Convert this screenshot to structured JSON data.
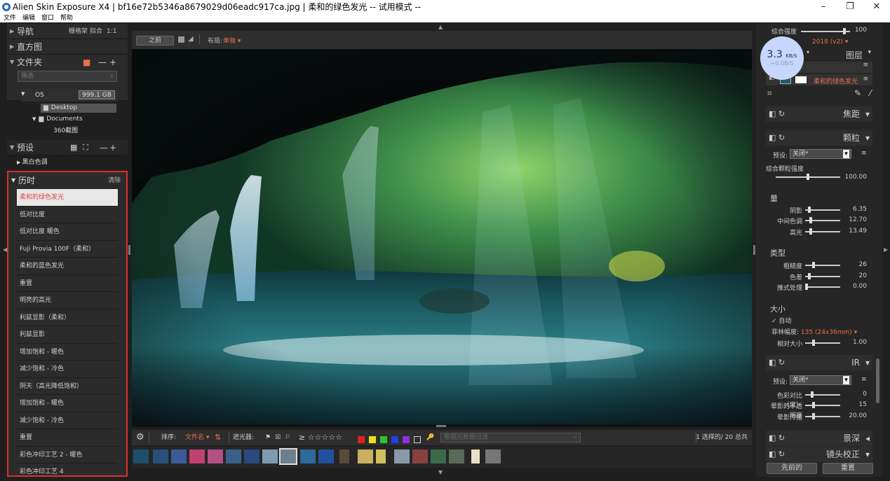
{
  "window": {
    "title": "Alien Skin Exposure X4 | bf16e72b5346a8679029d06eadc917ca.jpg | 柔和的绿色发光 -- 试用模式 --",
    "min": "–",
    "max": "❐",
    "close": "✕"
  },
  "menu": [
    "文件",
    "编辑",
    "窗口",
    "帮助"
  ],
  "left": {
    "nav": {
      "label": "导航",
      "opts": [
        "栅格架",
        "拟合",
        "1:1"
      ]
    },
    "histogram": "直方图",
    "folders": {
      "label": "文件夹",
      "filter_placeholder": "筛选",
      "drive": "OS",
      "drive_size": "999.1 GB",
      "tree": [
        "Desktop",
        "Documents",
        "360截图"
      ]
    },
    "presets": {
      "label": "预设",
      "item": "黑白色调"
    },
    "history": {
      "label": "历时",
      "clear": "清除",
      "items": [
        "柔和的绿色发光",
        "低对比度",
        "低对比度 暖色",
        "Fuji Provia 100F（柔和）",
        "柔和的蓝色发光",
        "重置",
        "明亮的高光",
        "利兹显影（柔和）",
        "利兹显影",
        "增加饱和 - 暖色",
        "减少饱和 - 冷色",
        "阴天（高光降低饱和）",
        "增加饱和 - 暖色",
        "减少饱和 - 冷色",
        "重置",
        "彩色冲印工艺 2 - 暖色",
        "彩色冲印工艺 4"
      ]
    }
  },
  "toolbar": {
    "before": "之前",
    "layout_label": "布局:",
    "layout_value": "单独"
  },
  "bottom": {
    "sort_label": "排序:",
    "sort_value": "文件名",
    "filter_label": "遮光器:",
    "stars": "☆☆☆☆☆",
    "search_placeholder": "根据元数据过滤",
    "count": "1 选择的/ 20 总共"
  },
  "colors": {
    "accent": "#e8704a",
    "red_border": "#d9302b",
    "swatches": [
      "#e02020",
      "#e8e020",
      "#30c030",
      "#2040e0",
      "#9030e0"
    ]
  },
  "right": {
    "overall_label": "综合强度",
    "overall_value": "100",
    "version": "2018 (v2)",
    "layers_label": "图层",
    "layer_name": "柔和的绿色发光",
    "net_speed": "3.3",
    "net_unit": "KB/S",
    "net_sub": "+0.0B/S",
    "focus": "焦距",
    "grain": "颗粒",
    "ir": "IR",
    "dof": "景深",
    "lens": "镜头校正",
    "preset_label": "预设:",
    "preset_value": "关闭*",
    "grain_overall": "综合颗粒强度",
    "grain_overall_val": "100.00",
    "amount": "量",
    "shadow": "阴影",
    "shadow_val": "6.35",
    "mid": "中间色调",
    "mid_val": "12.70",
    "high": "高光",
    "high_val": "13.49",
    "type": "类型",
    "rough": "粗糙度",
    "rough_val": "26",
    "color": "色差",
    "color_val": "20",
    "push": "推式处理",
    "push_val": "0.00",
    "size": "大小",
    "auto": "自动",
    "film_label": "菲林幅度:",
    "film_val": "135 (24x36mm)",
    "rel": "相对大小",
    "rel_val": "1.00",
    "ir_contrast": "色彩对比（度）",
    "ir_contrast_val": "0",
    "halo_op": "晕影的不透明度",
    "halo_op_val": "15",
    "halo_spread": "晕影传播",
    "halo_spread_val": "20.00",
    "prev": "先前的",
    "reset": "重置"
  }
}
